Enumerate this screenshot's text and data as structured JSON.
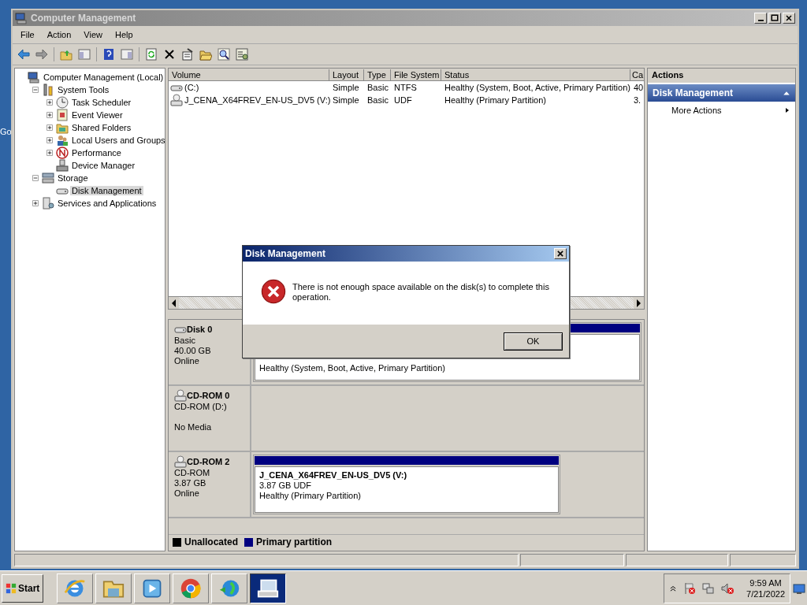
{
  "desktop": {
    "icon_label": "Go"
  },
  "window": {
    "title": "Computer Management"
  },
  "menu": [
    "File",
    "Action",
    "View",
    "Help"
  ],
  "tree": [
    {
      "label": "Computer Management (Local)",
      "selected": false,
      "children": [
        {
          "label": "System Tools",
          "expanded": true,
          "selected": false,
          "children": [
            {
              "label": "Task Scheduler",
              "expanded": false,
              "selected": false
            },
            {
              "label": "Event Viewer",
              "expanded": false,
              "selected": false
            },
            {
              "label": "Shared Folders",
              "expanded": false,
              "selected": false
            },
            {
              "label": "Local Users and Groups",
              "expanded": false,
              "selected": false
            },
            {
              "label": "Performance",
              "expanded": false,
              "selected": false
            },
            {
              "label": "Device Manager",
              "selected": false
            }
          ]
        },
        {
          "label": "Storage",
          "expanded": true,
          "selected": false,
          "children": [
            {
              "label": "Disk Management",
              "selected": true
            }
          ]
        },
        {
          "label": "Services and Applications",
          "expanded": false,
          "selected": false
        }
      ]
    }
  ],
  "volume_table": {
    "columns": [
      "Volume",
      "Layout",
      "Type",
      "File System",
      "Status",
      "Ca"
    ],
    "rows": [
      {
        "kind": "disk",
        "cells": [
          "(C:)",
          "Simple",
          "Basic",
          "NTFS",
          "Healthy (System, Boot, Active, Primary Partition)",
          "40"
        ]
      },
      {
        "kind": "cdrom",
        "cells": [
          "J_CENA_X64FREV_EN-US_DV5 (V:)",
          "Simple",
          "Basic",
          "UDF",
          "Healthy (Primary Partition)",
          "3."
        ]
      }
    ]
  },
  "disks": [
    {
      "kind": "disk",
      "name": "Disk 0",
      "type": "Basic",
      "size": "40.00 GB",
      "status": "Online",
      "partitions": [
        {
          "status": "Healthy (System, Boot, Active, Primary Partition)"
        }
      ]
    },
    {
      "kind": "cdrom",
      "name": "CD-ROM 0",
      "type": "CD-ROM (D:)",
      "status": "No Media"
    },
    {
      "kind": "cdrom",
      "name": "CD-ROM 2",
      "type": "CD-ROM",
      "size": "3.87 GB",
      "status": "Online",
      "partitions": [
        {
          "name": "J_CENA_X64FREV_EN-US_DV5  (V:)",
          "details": "3.87 GB UDF",
          "status": "Healthy (Primary Partition)"
        }
      ]
    }
  ],
  "legend": [
    {
      "label": "Unallocated",
      "color": "#000000"
    },
    {
      "label": "Primary partition",
      "color": "#000080"
    }
  ],
  "actions": {
    "title": "Actions",
    "section": "Disk Management",
    "expanded": true,
    "items": [
      {
        "label": "More Actions"
      }
    ]
  },
  "dialog": {
    "title": "Disk Management",
    "message": "There is not enough space available on the disk(s) to complete this operation.",
    "buttons": [
      "OK"
    ]
  },
  "taskbar": {
    "start": "Start",
    "apps": [
      {
        "selected": false
      },
      {
        "selected": false
      },
      {
        "selected": false
      },
      {
        "selected": false
      },
      {
        "selected": false
      },
      {
        "selected": true
      }
    ],
    "time": "9:59 AM",
    "date": "7/21/2022"
  }
}
